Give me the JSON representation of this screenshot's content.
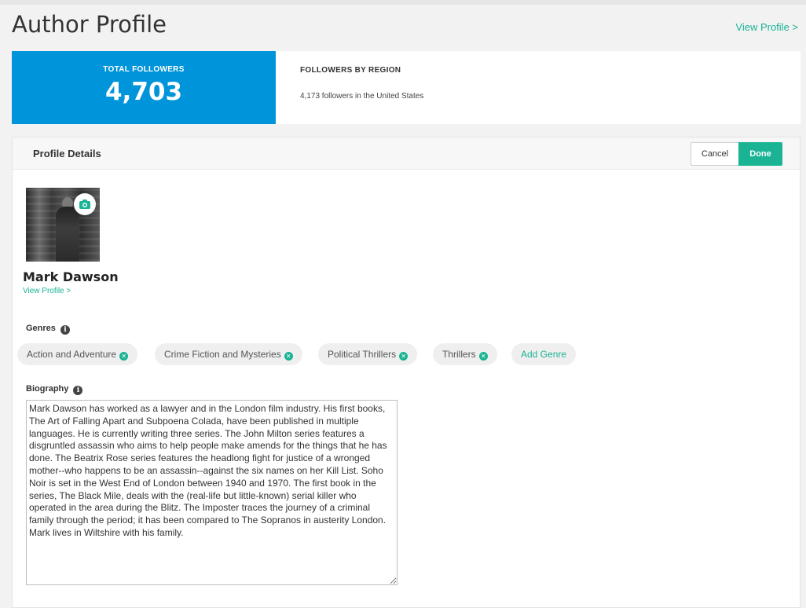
{
  "page": {
    "title": "Author Profile",
    "view_profile_link": "View Profile >"
  },
  "stats": {
    "total_label": "TOTAL FOLLOWERS",
    "total_value": "4,703",
    "region_label": "FOLLOWERS BY REGION",
    "region_text": "4,173 followers in the United States"
  },
  "panel": {
    "title": "Profile Details",
    "cancel_label": "Cancel",
    "done_label": "Done"
  },
  "author": {
    "name": "Mark Dawson",
    "view_profile_link": "View Profile >"
  },
  "genres": {
    "label": "Genres",
    "items": [
      "Action and Adventure",
      "Crime Fiction and Mysteries",
      "Political Thrillers",
      "Thrillers"
    ],
    "add_label": "Add Genre"
  },
  "biography": {
    "label": "Biography",
    "text": "Mark Dawson has worked as a lawyer and in the London film industry. His first books, The Art of Falling Apart and Subpoena Colada, have been published in multiple languages. He is currently writing three series. The John Milton series features a disgruntled assassin who aims to help people make amends for the things that he has done. The Beatrix Rose series features the headlong fight for justice of a wronged mother--who happens to be an assassin--against the six names on her Kill List. Soho Noir is set in the West End of London between 1940 and 1970. The first book in the series, The Black Mile, deals with the (real-life but little-known) serial killer who operated in the area during the Blitz. The Imposter traces the journey of a criminal family through the period; it has been compared to The Sopranos in austerity London. Mark lives in Wiltshire with his family."
  },
  "colors": {
    "accent": "#1ab394",
    "followers_bg": "#0095db"
  },
  "icons": {
    "camera": "camera-icon",
    "info": "info-icon",
    "remove": "remove-circle-icon"
  }
}
